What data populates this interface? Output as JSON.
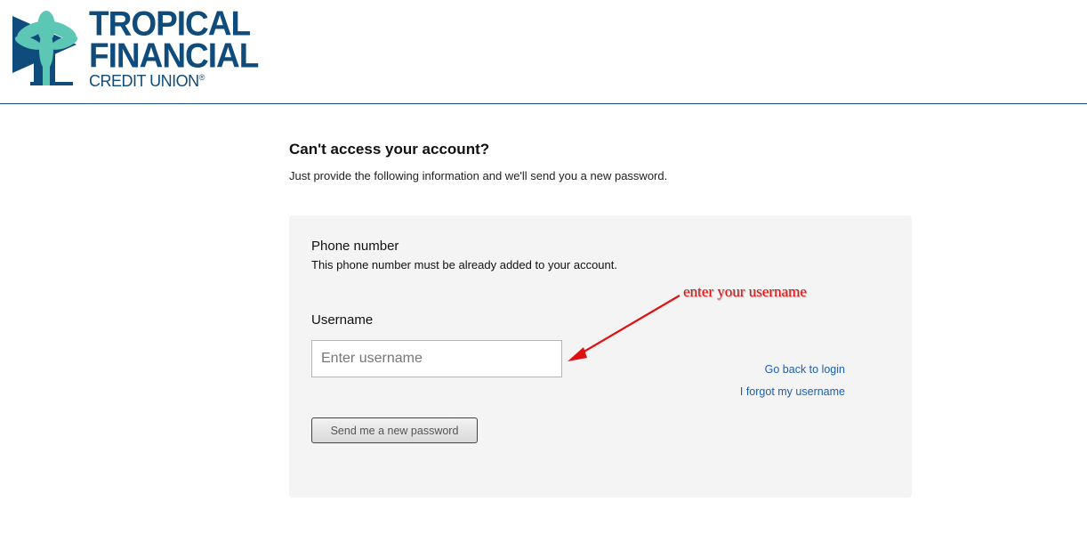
{
  "logo": {
    "line1": "TROPICAL",
    "line2": "FINANCIAL",
    "line3": "CREDIT UNION",
    "registered": "®",
    "brand_color": "#0f4c7c",
    "palm_color": "#5cc7b5"
  },
  "main": {
    "title": "Can't access your account?",
    "subtitle": "Just provide the following information and we'll send you a new password."
  },
  "form": {
    "phone_label": "Phone number",
    "phone_help": "This phone number must be already added to your account.",
    "username_label": "Username",
    "username_placeholder": "Enter username",
    "username_value": "",
    "send_button": "Send me a new password",
    "back_link": "Go back to login",
    "forgot_link": "I forgot my username"
  },
  "annotation": {
    "text": "enter your username",
    "color": "#e01010"
  }
}
